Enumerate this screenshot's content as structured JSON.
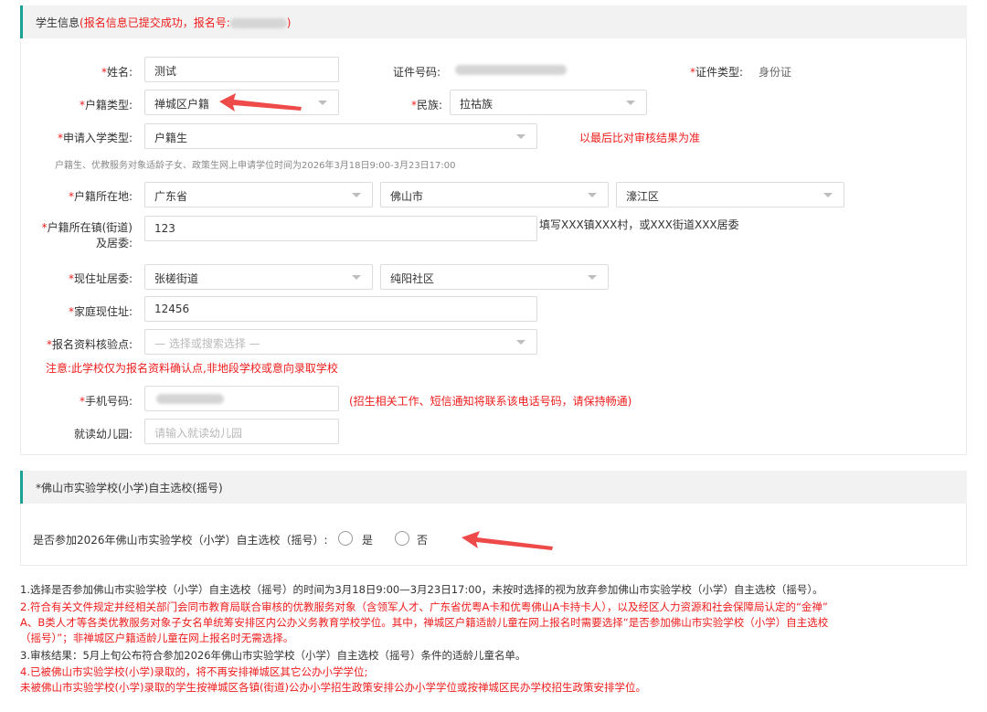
{
  "student_section": {
    "title": "学生信息",
    "status_note": "(报名信息已提交成功，报名号:",
    "status_note_end": ")"
  },
  "form": {
    "name": {
      "label": "*姓名:",
      "value": "测试"
    },
    "id_number": {
      "label": "证件号码:"
    },
    "id_type": {
      "label": "*证件类型:",
      "value": "身份证"
    },
    "hukou_type": {
      "label": "*户籍类型:",
      "value": "禅城区户籍"
    },
    "ethnicity": {
      "label": "*民族:",
      "value": "拉祜族"
    },
    "apply_type": {
      "label": "*申请入学类型:",
      "value": "户籍生",
      "note": "以最后比对审核结果为准"
    },
    "apply_hint": "户籍生、优教服务对象适龄子女、政策生网上申请学位时间为2026年3月18日9:00-3月23日17:00",
    "hukou_location": {
      "label": "*户籍所在地:",
      "province": "广东省",
      "city": "佛山市",
      "district": "濠江区"
    },
    "hukou_town": {
      "label_line1": "*户籍所在镇(街道)",
      "label_line2": "及居委:",
      "value": "123",
      "note": "填写XXX镇XXX村，或XXX街道XXX居委"
    },
    "residence_committee": {
      "label": "*现住址居委:",
      "street": "张槎街道",
      "community": "纯阳社区"
    },
    "home_address": {
      "label": "*家庭现住址:",
      "value": "12456"
    },
    "verify_point": {
      "label": "*报名资料核验点:",
      "placeholder": "— 选择或搜索选择 —",
      "warning": "注意:此学校仅为报名资料确认点,非地段学校或意向录取学校"
    },
    "phone": {
      "label": "*手机号码:",
      "note": "(招生相关工作、短信通知将联系该电话号码，请保持畅通)"
    },
    "kindergarten": {
      "label": "就读幼儿园:",
      "placeholder": "请输入就读幼儿园"
    }
  },
  "lottery_section": {
    "title": "*佛山市实验学校(小学)自主选校(摇号)",
    "question": "是否参加2026年佛山市实验学校（小学）自主选校（摇号）:",
    "option_yes": "是",
    "option_no": "否"
  },
  "notes": {
    "n1": "1.选择是否参加佛山市实验学校（小学）自主选校（摇号）的时间为3月18日9:00—3月23日17:00，未按时选择的视为放弃参加佛山市实验学校（小学）自主选校（摇号）。",
    "n2a": "2.符合有关文件规定并经相关部门会同市教育局联合审核的优教服务对象（含领军人才、广东省优粤A卡和优粤佛山A卡持卡人），以及经区人力资源和社会保障局认定的“金禅”",
    "n2b": "A、B类人才等各类优教服务对象子女名单统筹安排区内公办义务教育学校学位。其中，禅城区户籍适龄儿童在网上报名时需要选择“是否参加佛山市实验学校（小学）自主选校",
    "n2c": "（摇号）”；非禅城区户籍适龄儿童在网上报名时无需选择。",
    "n3": "3.审核结果：5月上旬公布符合参加2026年佛山市实验学校（小学）自主选校（摇号）条件的适龄儿童名单。",
    "n4a": "4.已被佛山市实验学校(小学)录取的，将不再安排禅城区其它公办小学学位;",
    "n4b": "未被佛山市实验学校(小学)录取的学生按禅城区各镇(街道)公办小学招生政策安排公办小学学位或按禅城区民办学校招生政策安排学位。"
  },
  "colors": {
    "accent": "#1aa394",
    "warning": "#ee1c1c",
    "arrow": "#ef4a4a"
  }
}
